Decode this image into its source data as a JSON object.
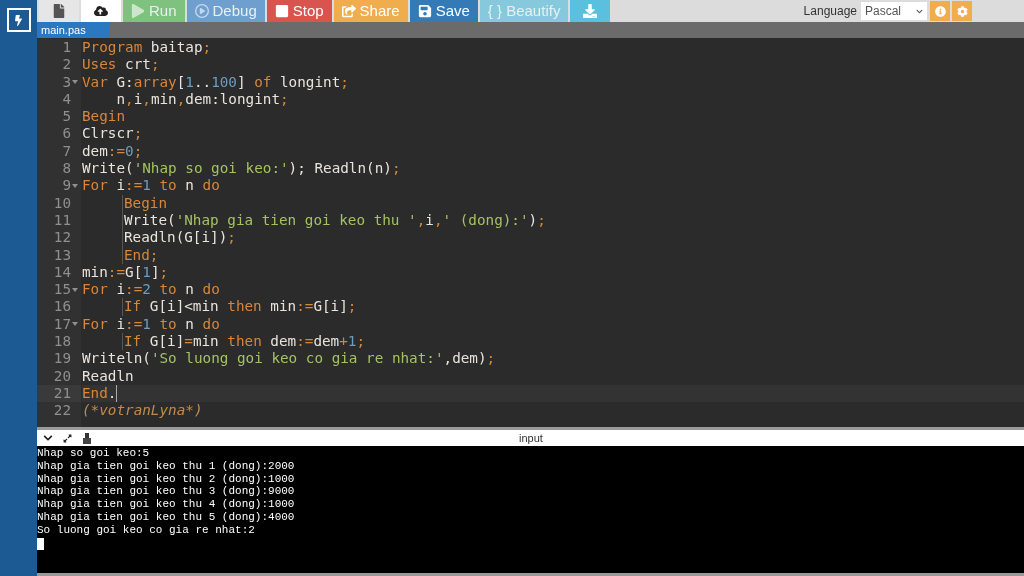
{
  "toolbar": {
    "buttons": [
      {
        "kind": "new-file",
        "color": "#e6e6e6",
        "disabled": false
      },
      {
        "kind": "upload",
        "color": "#ffffff",
        "disabled": false
      },
      {
        "kind": "run",
        "label": "Run",
        "color": "#7fc17f",
        "disabled": true
      },
      {
        "kind": "debug",
        "label": "Debug",
        "color": "#6f9fcf",
        "disabled": true
      },
      {
        "kind": "stop",
        "label": "Stop",
        "color": "#d9534f",
        "disabled": false
      },
      {
        "kind": "share",
        "label": "Share",
        "color": "#f0ad4e",
        "disabled": false
      },
      {
        "kind": "save",
        "label": "Save",
        "color": "#337ab7",
        "disabled": false
      },
      {
        "kind": "beautify",
        "label": "{ } Beautify",
        "color": "#86c8dc",
        "disabled": true
      },
      {
        "kind": "download",
        "color": "#5bc0de",
        "disabled": false
      }
    ],
    "language_label": "Language",
    "language": "Pascal"
  },
  "file_tabs": [
    {
      "label": "main.pas",
      "selected": true
    }
  ],
  "editor": {
    "lines": [
      {
        "number": "1",
        "cursor": false,
        "foldable": false,
        "guide": false,
        "tokens": [
          {
            "kind": "k",
            "text": "Program"
          },
          {
            "kind": "t",
            "text": " baitap"
          },
          {
            "kind": "p",
            "text": ";"
          }
        ]
      },
      {
        "number": "2",
        "cursor": false,
        "foldable": false,
        "guide": false,
        "tokens": [
          {
            "kind": "k",
            "text": "Uses"
          },
          {
            "kind": "t",
            "text": " crt"
          },
          {
            "kind": "p",
            "text": ";"
          }
        ]
      },
      {
        "number": "3",
        "cursor": false,
        "foldable": true,
        "guide": false,
        "tokens": [
          {
            "kind": "k",
            "text": "Var"
          },
          {
            "kind": "t",
            "text": " G:"
          },
          {
            "kind": "k",
            "text": "array"
          },
          {
            "kind": "t",
            "text": "["
          },
          {
            "kind": "n",
            "text": "1"
          },
          {
            "kind": "t",
            "text": ".."
          },
          {
            "kind": "n",
            "text": "100"
          },
          {
            "kind": "t",
            "text": "] "
          },
          {
            "kind": "k",
            "text": "of"
          },
          {
            "kind": "t",
            "text": " longint"
          },
          {
            "kind": "p",
            "text": ";"
          }
        ]
      },
      {
        "number": "4",
        "cursor": false,
        "foldable": false,
        "guide": false,
        "tokens": [
          {
            "kind": "t",
            "text": "    n"
          },
          {
            "kind": "p",
            "text": ","
          },
          {
            "kind": "t",
            "text": "i"
          },
          {
            "kind": "p",
            "text": ","
          },
          {
            "kind": "t",
            "text": "min"
          },
          {
            "kind": "p",
            "text": ","
          },
          {
            "kind": "t",
            "text": "dem:longint"
          },
          {
            "kind": "p",
            "text": ";"
          }
        ]
      },
      {
        "number": "5",
        "cursor": false,
        "foldable": false,
        "guide": false,
        "tokens": [
          {
            "kind": "k",
            "text": "Begin"
          }
        ]
      },
      {
        "number": "6",
        "cursor": false,
        "foldable": false,
        "guide": false,
        "tokens": [
          {
            "kind": "t",
            "text": "Clrscr"
          },
          {
            "kind": "p",
            "text": ";"
          }
        ]
      },
      {
        "number": "7",
        "cursor": false,
        "foldable": false,
        "guide": false,
        "tokens": [
          {
            "kind": "t",
            "text": "dem"
          },
          {
            "kind": "p",
            "text": ":="
          },
          {
            "kind": "n",
            "text": "0"
          },
          {
            "kind": "p",
            "text": ";"
          }
        ]
      },
      {
        "number": "8",
        "cursor": false,
        "foldable": false,
        "guide": false,
        "tokens": [
          {
            "kind": "t",
            "text": "Write("
          },
          {
            "kind": "s",
            "text": "'Nhap so goi keo:'"
          },
          {
            "kind": "t",
            "text": "); Readln(n)"
          },
          {
            "kind": "p",
            "text": ";"
          }
        ]
      },
      {
        "number": "9",
        "cursor": false,
        "foldable": true,
        "guide": false,
        "tokens": [
          {
            "kind": "k",
            "text": "For"
          },
          {
            "kind": "t",
            "text": " i"
          },
          {
            "kind": "p",
            "text": ":="
          },
          {
            "kind": "n",
            "text": "1"
          },
          {
            "kind": "k",
            "text": " to"
          },
          {
            "kind": "t",
            "text": " n "
          },
          {
            "kind": "k",
            "text": "do"
          }
        ]
      },
      {
        "number": "10",
        "cursor": false,
        "foldable": false,
        "guide": true,
        "tokens": [
          {
            "kind": "k",
            "text": "Begin"
          }
        ]
      },
      {
        "number": "11",
        "cursor": false,
        "foldable": false,
        "guide": true,
        "tokens": [
          {
            "kind": "t",
            "text": "Write("
          },
          {
            "kind": "s",
            "text": "'Nhap gia tien goi keo thu '"
          },
          {
            "kind": "p",
            "text": ","
          },
          {
            "kind": "t",
            "text": "i"
          },
          {
            "kind": "p",
            "text": ","
          },
          {
            "kind": "s",
            "text": "' (dong):'"
          },
          {
            "kind": "t",
            "text": ")"
          },
          {
            "kind": "p",
            "text": ";"
          }
        ]
      },
      {
        "number": "12",
        "cursor": false,
        "foldable": false,
        "guide": true,
        "tokens": [
          {
            "kind": "t",
            "text": "Readln(G[i])"
          },
          {
            "kind": "p",
            "text": ";"
          }
        ]
      },
      {
        "number": "13",
        "cursor": false,
        "foldable": false,
        "guide": true,
        "tokens": [
          {
            "kind": "k",
            "text": "End"
          },
          {
            "kind": "p",
            "text": ";"
          }
        ]
      },
      {
        "number": "14",
        "cursor": false,
        "foldable": false,
        "guide": false,
        "tokens": [
          {
            "kind": "t",
            "text": "min"
          },
          {
            "kind": "p",
            "text": ":="
          },
          {
            "kind": "t",
            "text": "G["
          },
          {
            "kind": "n",
            "text": "1"
          },
          {
            "kind": "t",
            "text": "]"
          },
          {
            "kind": "p",
            "text": ";"
          }
        ]
      },
      {
        "number": "15",
        "cursor": false,
        "foldable": true,
        "guide": false,
        "tokens": [
          {
            "kind": "k",
            "text": "For"
          },
          {
            "kind": "t",
            "text": " i"
          },
          {
            "kind": "p",
            "text": ":="
          },
          {
            "kind": "n",
            "text": "2"
          },
          {
            "kind": "k",
            "text": " to"
          },
          {
            "kind": "t",
            "text": " n "
          },
          {
            "kind": "k",
            "text": "do"
          }
        ]
      },
      {
        "number": "16",
        "cursor": false,
        "foldable": false,
        "guide": true,
        "tokens": [
          {
            "kind": "k",
            "text": "If"
          },
          {
            "kind": "t",
            "text": " G[i]<min "
          },
          {
            "kind": "k",
            "text": "then"
          },
          {
            "kind": "t",
            "text": " min"
          },
          {
            "kind": "p",
            "text": ":="
          },
          {
            "kind": "t",
            "text": "G[i]"
          },
          {
            "kind": "p",
            "text": ";"
          }
        ]
      },
      {
        "number": "17",
        "cursor": false,
        "foldable": true,
        "guide": false,
        "tokens": [
          {
            "kind": "k",
            "text": "For"
          },
          {
            "kind": "t",
            "text": " i"
          },
          {
            "kind": "p",
            "text": ":="
          },
          {
            "kind": "n",
            "text": "1"
          },
          {
            "kind": "k",
            "text": " to"
          },
          {
            "kind": "t",
            "text": " n "
          },
          {
            "kind": "k",
            "text": "do"
          }
        ]
      },
      {
        "number": "18",
        "cursor": false,
        "foldable": false,
        "guide": true,
        "tokens": [
          {
            "kind": "k",
            "text": "If"
          },
          {
            "kind": "t",
            "text": " G[i]"
          },
          {
            "kind": "p",
            "text": "="
          },
          {
            "kind": "t",
            "text": "min "
          },
          {
            "kind": "k",
            "text": "then"
          },
          {
            "kind": "t",
            "text": " dem"
          },
          {
            "kind": "p",
            "text": ":="
          },
          {
            "kind": "t",
            "text": "dem"
          },
          {
            "kind": "p",
            "text": "+"
          },
          {
            "kind": "n",
            "text": "1"
          },
          {
            "kind": "p",
            "text": ";"
          }
        ]
      },
      {
        "number": "19",
        "cursor": false,
        "foldable": false,
        "guide": false,
        "tokens": [
          {
            "kind": "t",
            "text": "Writeln("
          },
          {
            "kind": "s",
            "text": "'So luong goi keo co gia re nhat:'"
          },
          {
            "kind": "t",
            "text": ",dem)"
          },
          {
            "kind": "p",
            "text": ";"
          }
        ]
      },
      {
        "number": "20",
        "cursor": false,
        "foldable": false,
        "guide": false,
        "tokens": [
          {
            "kind": "t",
            "text": "Readln"
          }
        ]
      },
      {
        "number": "21",
        "cursor": true,
        "foldable": false,
        "guide": false,
        "tokens": [
          {
            "kind": "k",
            "text": "End"
          },
          {
            "kind": "t",
            "text": "."
          }
        ]
      },
      {
        "number": "22",
        "cursor": false,
        "foldable": false,
        "guide": false,
        "tokens": [
          {
            "kind": "c",
            "text": "(*votranLyna*)"
          }
        ]
      }
    ]
  },
  "console": {
    "title": "input",
    "lines": [
      "Nhap so goi keo:5",
      "Nhap gia tien goi keo thu 1 (dong):2000",
      "Nhap gia tien goi keo thu 2 (dong):1000",
      "Nhap gia tien goi keo thu 3 (dong):9000",
      "Nhap gia tien goi keo thu 4 (dong):1000",
      "Nhap gia tien goi keo thu 5 (dong):4000",
      "So luong goi keo co gia re nhat:2"
    ],
    "cursor": true
  }
}
